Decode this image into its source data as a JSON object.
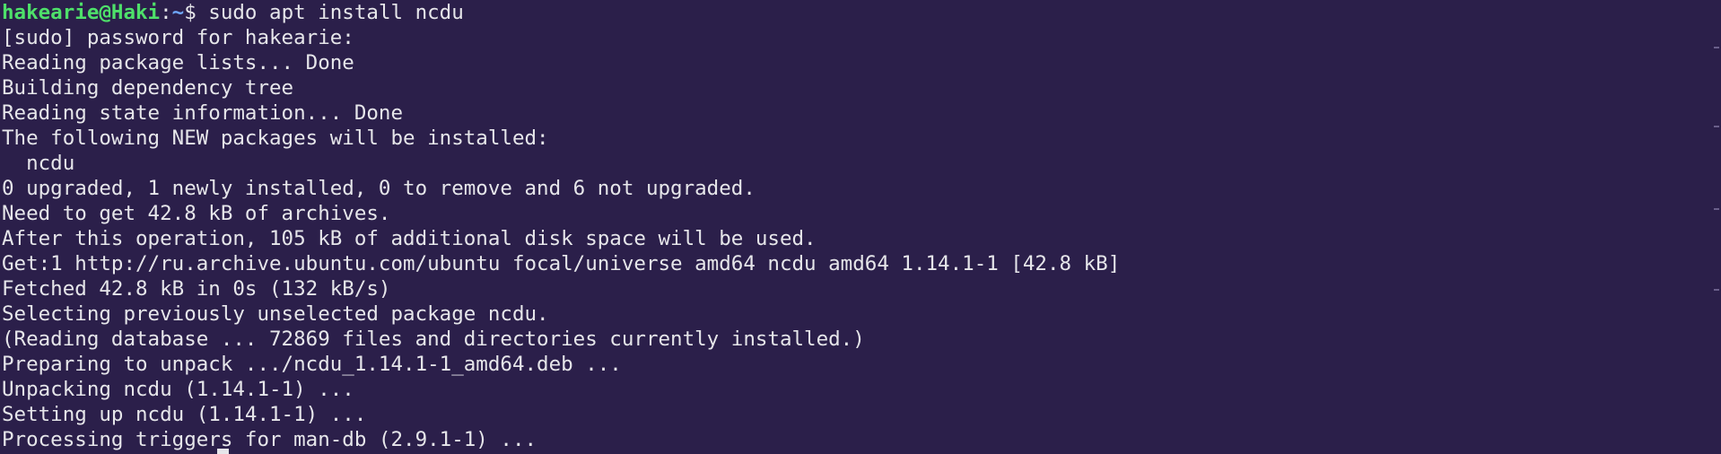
{
  "terminal": {
    "prompt": {
      "user_host": "hakearie@Haki",
      "separator": ":",
      "path": "~",
      "symbol": "$ ",
      "command": "sudo apt install ncdu"
    },
    "output_lines": [
      "[sudo] password for hakearie:",
      "Reading package lists... Done",
      "Building dependency tree",
      "Reading state information... Done",
      "The following NEW packages will be installed:",
      "  ncdu",
      "0 upgraded, 1 newly installed, 0 to remove and 6 not upgraded.",
      "Need to get 42.8 kB of archives.",
      "After this operation, 105 kB of additional disk space will be used.",
      "Get:1 http://ru.archive.ubuntu.com/ubuntu focal/universe amd64 ncdu amd64 1.14.1-1 [42.8 kB]",
      "Fetched 42.8 kB in 0s (132 kB/s)",
      "Selecting previously unselected package ncdu.",
      "(Reading database ... 72869 files and directories currently installed.)",
      "Preparing to unpack .../ncdu_1.14.1-1_amd64.deb ...",
      "Unpacking ncdu (1.14.1-1) ...",
      "Setting up ncdu (1.14.1-1) ...",
      "Processing triggers for man-db (2.9.1-1) ..."
    ]
  },
  "colors": {
    "background": "#2b1f4a",
    "text": "#e6e6ea",
    "prompt_user": "#4ee06a",
    "prompt_path": "#6fa8ff"
  }
}
